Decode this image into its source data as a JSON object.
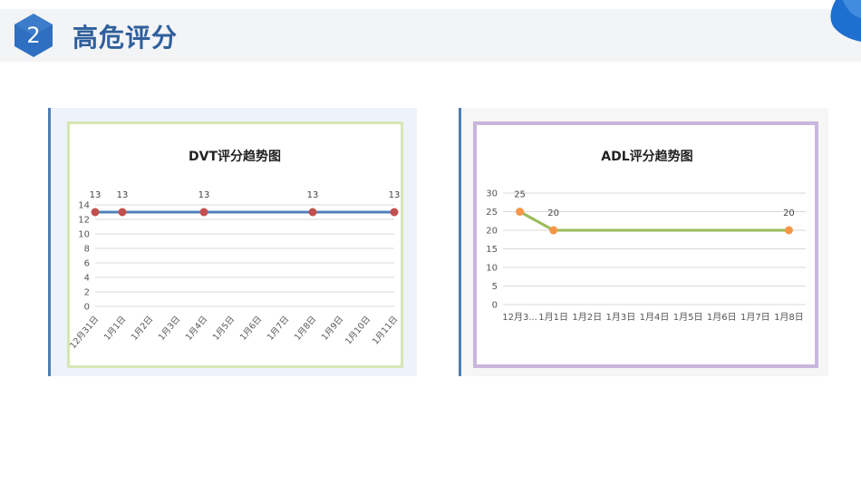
{
  "page": {
    "section_number": "2",
    "title": "高危评分"
  },
  "colors": {
    "accent": "#2f5f9c",
    "badge": "#2e6fc1",
    "dvt_line": "#4f81bd",
    "dvt_marker": "#c0504d",
    "adl_line": "#9bbb59",
    "adl_marker": "#f79646"
  },
  "chart_data": [
    {
      "type": "line",
      "title": "DVT评分趋势图",
      "categories": [
        "12月31日",
        "1月1日",
        "1月2日",
        "1月3日",
        "1月4日",
        "1月5日",
        "1月6日",
        "1月7日",
        "1月8日",
        "1月9日",
        "1月10日",
        "1月11日"
      ],
      "series": [
        {
          "values": [
            13,
            13,
            null,
            null,
            13,
            null,
            null,
            null,
            13,
            null,
            null,
            13
          ]
        }
      ],
      "data_labels": [
        "13",
        "13",
        "13",
        "13",
        "13"
      ],
      "yticks": [
        "0",
        "2",
        "4",
        "6",
        "8",
        "10",
        "12",
        "14"
      ],
      "ylim": [
        0,
        14
      ],
      "grid": true,
      "xlabel": "",
      "ylabel": ""
    },
    {
      "type": "line",
      "title": "ADL评分趋势图",
      "categories": [
        "12月3...",
        "1月1日",
        "1月2日",
        "1月3日",
        "1月4日",
        "1月5日",
        "1月6日",
        "1月7日",
        "1月8日"
      ],
      "series": [
        {
          "values": [
            25,
            20,
            null,
            null,
            null,
            null,
            null,
            null,
            20
          ]
        }
      ],
      "data_labels": [
        "25",
        "20",
        "20"
      ],
      "yticks": [
        "0",
        "5",
        "10",
        "15",
        "20",
        "25",
        "30"
      ],
      "ylim": [
        0,
        30
      ],
      "grid": true,
      "xlabel": "",
      "ylabel": ""
    }
  ]
}
